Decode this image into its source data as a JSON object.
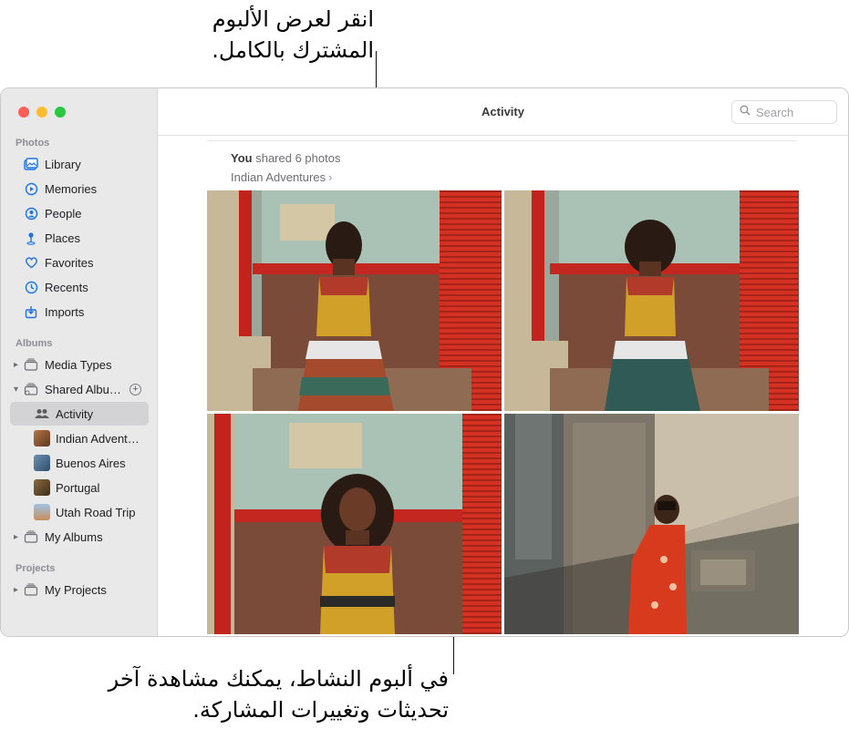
{
  "callouts": {
    "top": "انقر لعرض الألبوم المشترك بالكامل.",
    "bottom": "في ألبوم النشاط، يمكنك مشاهدة آخر تحديثات وتغييرات المشاركة."
  },
  "sidebar": {
    "sections": {
      "photos": "Photos",
      "albums": "Albums",
      "projects": "Projects"
    },
    "photos_items": [
      {
        "label": "Library",
        "icon": "library-icon"
      },
      {
        "label": "Memories",
        "icon": "memories-icon"
      },
      {
        "label": "People",
        "icon": "people-icon"
      },
      {
        "label": "Places",
        "icon": "places-icon"
      },
      {
        "label": "Favorites",
        "icon": "heart-icon"
      },
      {
        "label": "Recents",
        "icon": "clock-icon"
      },
      {
        "label": "Imports",
        "icon": "import-icon"
      }
    ],
    "albums_items": {
      "media_types": "Media Types",
      "shared_albums": "Shared Albu…",
      "activity": "Activity",
      "indian": "Indian Advent…",
      "buenos": "Buenos Aires",
      "portugal": "Portugal",
      "utah": "Utah Road Trip",
      "my_albums": "My Albums"
    },
    "projects_items": {
      "my_projects": "My Projects"
    }
  },
  "toolbar": {
    "title": "Activity",
    "search_placeholder": "Search"
  },
  "feed": {
    "actor": "You",
    "action": "shared 6 photos",
    "album": "Indian Adventures"
  },
  "colors": {
    "accent": "#1a73e8",
    "sidebar_bg": "#e9e9ea",
    "selected_bg": "#d3d3d6"
  }
}
